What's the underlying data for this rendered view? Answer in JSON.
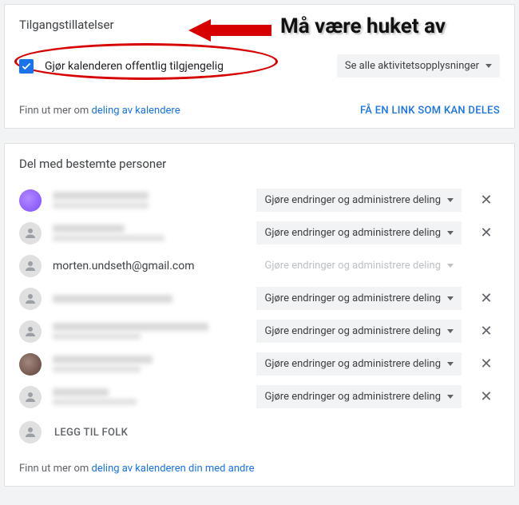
{
  "access": {
    "title": "Tilgangstillatelser",
    "public_label": "Gjør kalenderen offentlig tilgjengelig",
    "visibility_label": "Se alle aktivitetsopplysninger",
    "help_prefix": "Finn ut mer om ",
    "help_link": "deling av kalendere",
    "share_link_button": "FÅ EN LINK SOM KAN DELES",
    "callout": "Må være huket av"
  },
  "share": {
    "title": "Del med bestemte personer",
    "perm_label": "Gjøre endringer og administrere deling",
    "people": [
      {
        "email": "morten.undseth@gmail.com"
      }
    ],
    "add_label": "LEGG TIL FOLK",
    "help_prefix": "Finn ut mer om ",
    "help_link": "deling av kalenderen din med andre"
  }
}
